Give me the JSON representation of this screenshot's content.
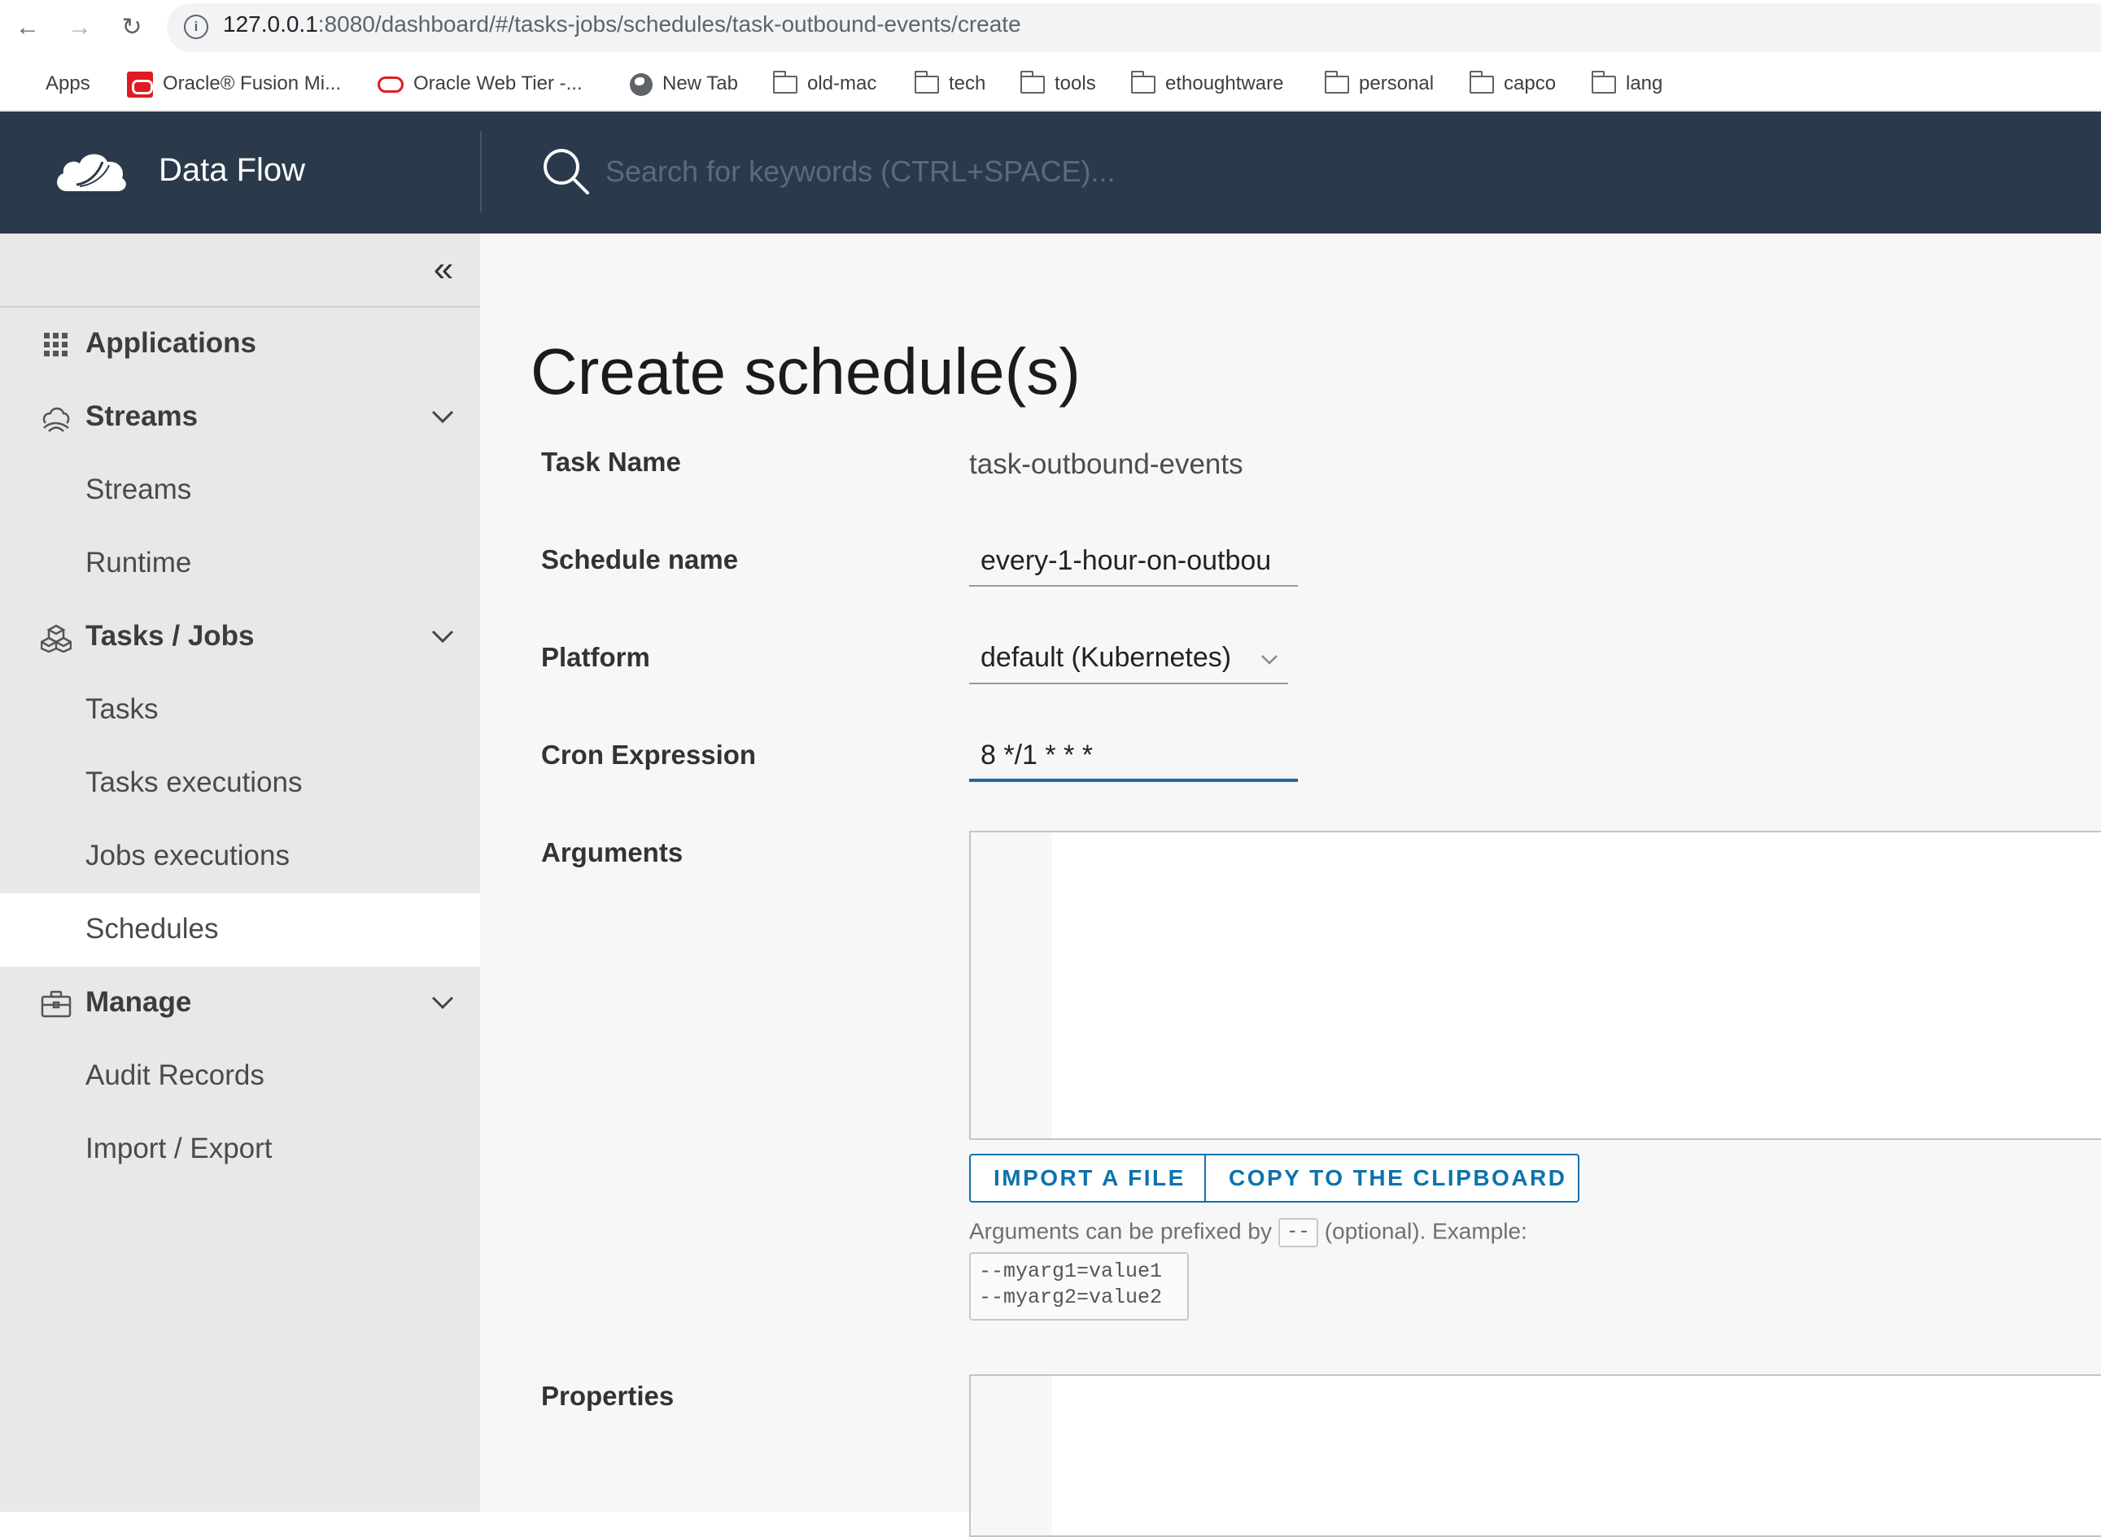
{
  "browser": {
    "url_host": "127.0.0.1",
    "url_rest": ":8080/dashboard/#/tasks-jobs/schedules/task-outbound-events/create",
    "bookmarks": [
      "Apps",
      "Oracle® Fusion Mi...",
      "Oracle Web Tier -...",
      "New Tab",
      "old-mac",
      "tech",
      "tools",
      "ethoughtware",
      "personal",
      "capco",
      "lang"
    ]
  },
  "header": {
    "brand": "Data Flow",
    "search_placeholder": "Search for keywords (CTRL+SPACE)..."
  },
  "sidebar": {
    "items": [
      {
        "label": "Applications",
        "type": "section",
        "icon": "grid-icon"
      },
      {
        "label": "Streams",
        "type": "section",
        "icon": "streams-icon",
        "expandable": true
      },
      {
        "label": "Streams",
        "type": "sub"
      },
      {
        "label": "Runtime",
        "type": "sub"
      },
      {
        "label": "Tasks / Jobs",
        "type": "section",
        "icon": "tasks-icon",
        "expandable": true
      },
      {
        "label": "Tasks",
        "type": "sub"
      },
      {
        "label": "Tasks executions",
        "type": "sub"
      },
      {
        "label": "Jobs executions",
        "type": "sub"
      },
      {
        "label": "Schedules",
        "type": "sub",
        "active": true
      },
      {
        "label": "Manage",
        "type": "section",
        "icon": "briefcase-icon",
        "expandable": true
      },
      {
        "label": "Audit Records",
        "type": "sub"
      },
      {
        "label": "Import / Export",
        "type": "sub"
      }
    ]
  },
  "main": {
    "title": "Create schedule(s)",
    "form": {
      "task_name_label": "Task Name",
      "task_name_value": "task-outbound-events",
      "schedule_name_label": "Schedule name",
      "schedule_name_value": "every-1-hour-on-outbou",
      "platform_label": "Platform",
      "platform_value": "default (Kubernetes)",
      "cron_label": "Cron Expression",
      "cron_value": "8 */1 * * *",
      "arguments_label": "Arguments",
      "properties_label": "Properties"
    },
    "buttons": {
      "import": "IMPORT A FILE",
      "copy": "COPY TO THE CLIPBOARD"
    },
    "help": {
      "prefix_text": "Arguments can be prefixed by",
      "prefix_code": "--",
      "suffix_text": "(optional). Example:",
      "example_line1": "--myarg1=value1",
      "example_line2": "--myarg2=value2"
    }
  },
  "colors": {
    "header_bg": "#2b3a4a",
    "accent": "#0b73ad",
    "sidebar_bg": "#e8e8e8"
  }
}
